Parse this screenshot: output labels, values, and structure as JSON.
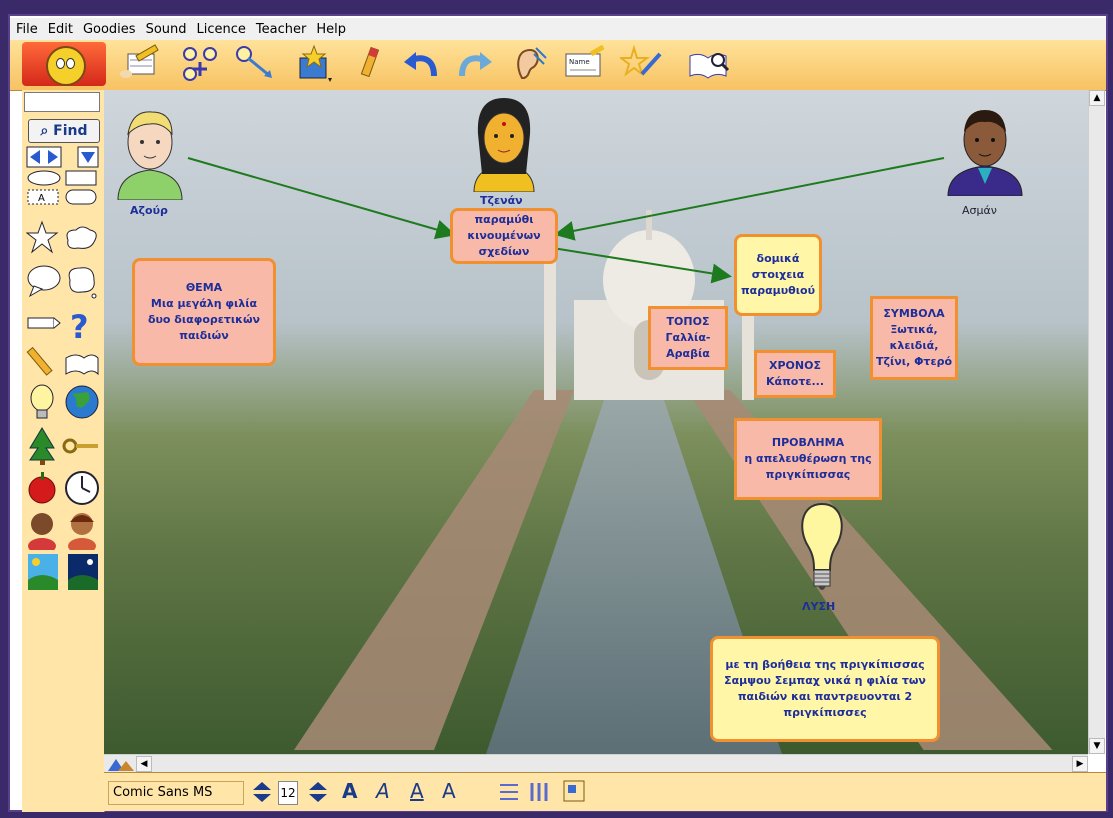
{
  "menu": [
    "File",
    "Edit",
    "Goodies",
    "Sound",
    "Licence",
    "Teacher",
    "Help"
  ],
  "toolbar": {
    "tools": [
      "pencil-notebook-icon",
      "network-icon",
      "arrow-connect-icon",
      "star-box-icon",
      "crayon-icon",
      "undo-icon",
      "redo-icon",
      "ear-icon",
      "name-icon",
      "sparkle-brush-icon",
      "book-search-icon"
    ],
    "name_label": "Name"
  },
  "sidebar": {
    "find_label": "Find",
    "search_value": ""
  },
  "people": [
    {
      "name": "Αζούρ"
    },
    {
      "name": "Τζενάν"
    },
    {
      "name": "Ασμάν"
    }
  ],
  "cards": {
    "center": "παραμύθι\nκινουμένων σχεδίων",
    "elements": "δομικά\nστοιχεια\nπαραμυθιού",
    "theme": "ΘΕΜΑ\nΜια μεγάλη φιλία\nδυο διαφορετικών\nπαιδιών",
    "place": "ΤΟΠΟΣ\nΓαλλία-\nΑραβία",
    "time": "ΧΡΟΝΟΣ\nΚάποτε...",
    "symbols": "ΣΥΜΒΟΛΑ\nΞωτικά,\nκλειδιά,\nΤζίνι, Φτερό",
    "problem": "ΠΡΟΒΛΗΜΑ\nη απελευθέρωση της\nπριγκίπισσας",
    "solution_label": "ΛΥΣΗ",
    "solution": "με τη βοήθεια της πριγκίπισσας\nΣαμψου Σεμπαχ νικά η φιλία των\nπαιδιών και παντρευονται 2\nπριγκίπισσες"
  },
  "bottombar": {
    "font_name": "Comic Sans MS",
    "font_size": "12"
  },
  "colors": {
    "card_border": "#f09030",
    "pink_card": "#f9b9a9",
    "yellow_card": "#fff6a8",
    "text_blue": "#1d2e9a",
    "arrow_green": "#1e7a1e"
  }
}
